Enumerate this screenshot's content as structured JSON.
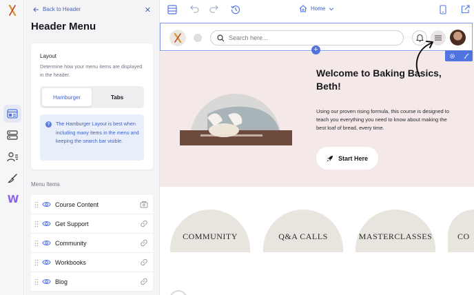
{
  "panel": {
    "back_label": "Back to Header",
    "title": "Header Menu",
    "layout": {
      "title": "Layout",
      "description": "Determine how your menu items are displayed in the header.",
      "options": [
        "Hamburger",
        "Tabs"
      ],
      "selected": "Hamburger",
      "info": "The Hamburger Layout is best when including many items in the menu and keeping the search bar visible."
    },
    "menu_items_label": "Menu Items",
    "menu_items": [
      {
        "label": "Course Content",
        "icon": "content-icon"
      },
      {
        "label": "Get Support",
        "icon": "link-icon"
      },
      {
        "label": "Community",
        "icon": "link-icon"
      },
      {
        "label": "Workbooks",
        "icon": "link-icon"
      },
      {
        "label": "Blog",
        "icon": "link-icon"
      }
    ]
  },
  "toolbar": {
    "page_selector": "Home"
  },
  "site": {
    "search_placeholder": "Search here...",
    "hero_title": "Welcome to Baking Basics, Beth!",
    "hero_text": "Using our proven rising formula, this course is designed to teach you everything you need to know about making the best loaf of bread, every time.",
    "start_button": "Start Here",
    "categories": [
      "COMMUNITY",
      "Q&A CALLS",
      "MASTERCLASSES",
      "CO"
    ]
  },
  "colors": {
    "accent": "#4f74e0",
    "hero_bg": "#f4e8e9",
    "category_bg": "#e8e5df"
  }
}
